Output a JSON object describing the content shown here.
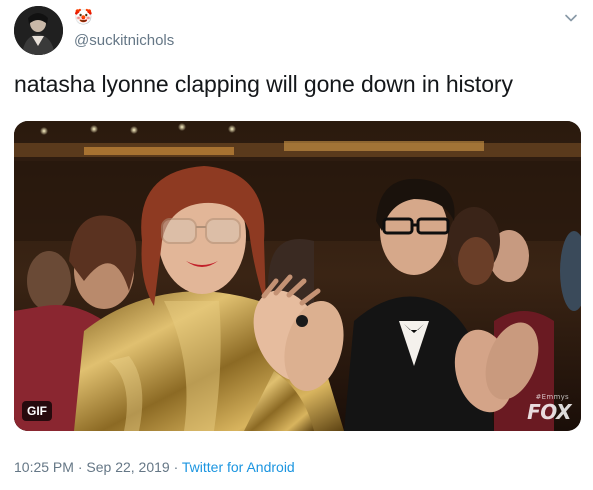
{
  "author": {
    "display_name_emoji": "🤡",
    "handle": "@suckitnichols"
  },
  "tweet": {
    "text": "natasha lyonne clapping will gone down in history"
  },
  "media": {
    "badge": "GIF",
    "network_tag": "#Emmys",
    "network_logo": "FOX"
  },
  "meta": {
    "time": "10:25 PM",
    "separator_1": " · ",
    "date": "Sep 22, 2019",
    "separator_2": " · ",
    "source": "Twitter for Android"
  },
  "icons": {
    "avatar": "profile-photo",
    "caret": "chevron-down-icon"
  },
  "colors": {
    "text_primary": "#14171a",
    "text_secondary": "#657786",
    "link": "#1b95e0"
  }
}
